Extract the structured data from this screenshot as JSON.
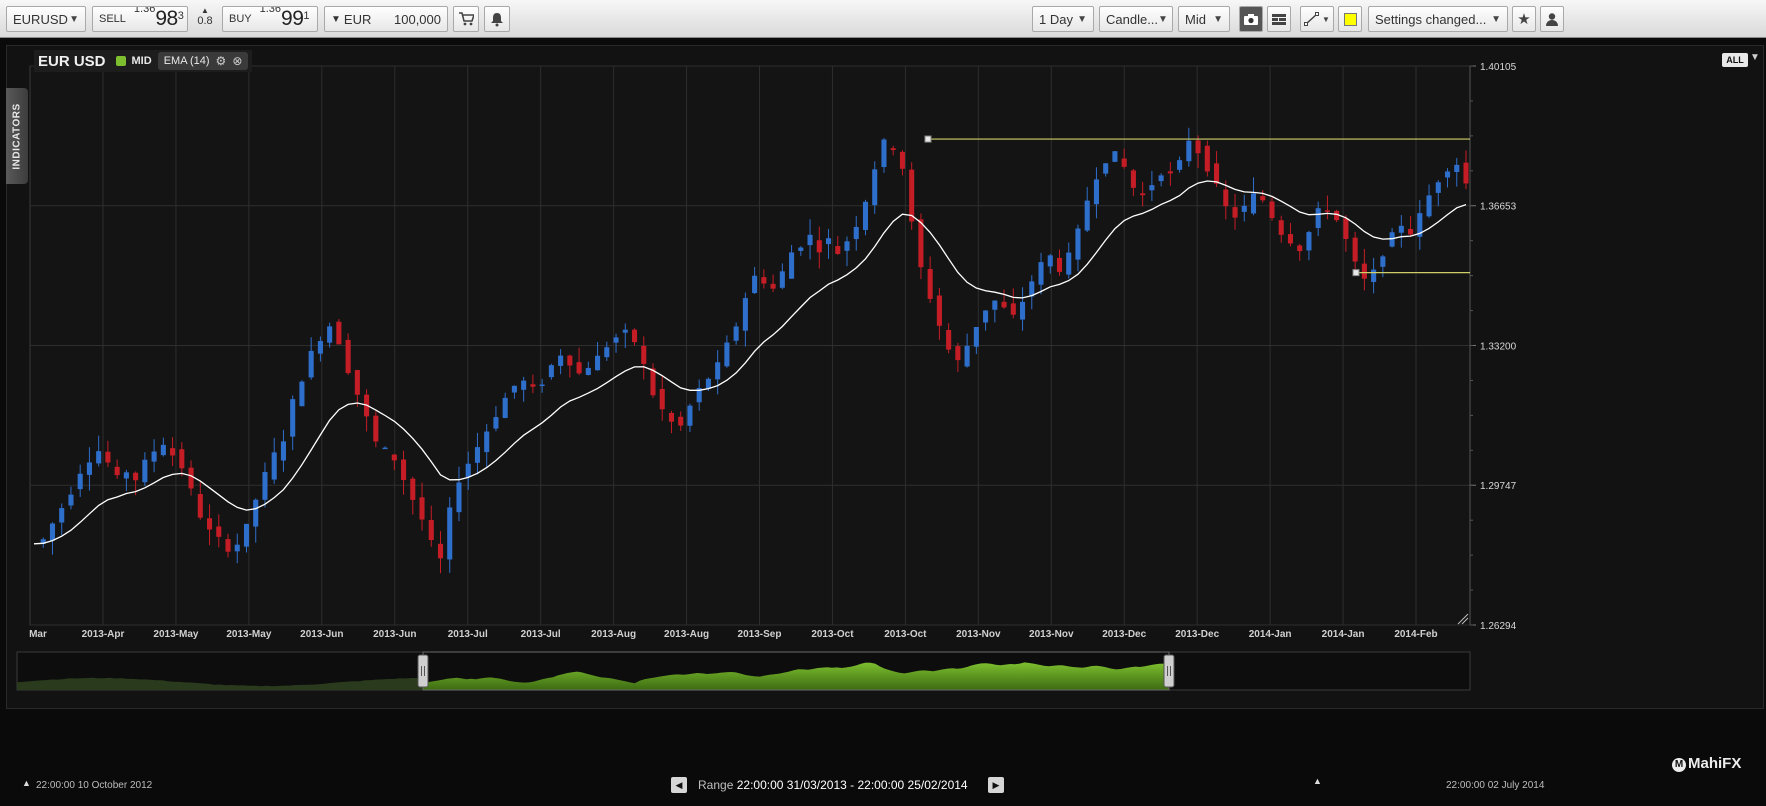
{
  "toolbar": {
    "symbol": "EURUSD",
    "sell_label": "SELL",
    "sell_price_prefix": "1.36",
    "sell_price_big": "98",
    "sell_price_sup": "3",
    "spread": "0.8",
    "buy_label": "BUY",
    "buy_price_prefix": "1.36",
    "buy_price_big": "99",
    "buy_price_sup": "1",
    "currency": "EUR",
    "amount": "100,000",
    "timeframe": "1 Day",
    "chart_type": "Candle...",
    "price_type": "Mid",
    "settings_status": "Settings changed..."
  },
  "legend": {
    "symbol_title": "EUR USD",
    "mid_label": "MID",
    "indicator_label": "EMA (14)"
  },
  "indicators_tab": "INDICATORS",
  "all_button": "ALL",
  "colors": {
    "up": "#2f6fcc",
    "down": "#c51d26",
    "ema": "#ffffff",
    "trendline": "#cfcf6a",
    "navigator_fill": "#7dbf2f"
  },
  "chart_data": {
    "type": "candlestick",
    "y_axis_ticks": [
      "1.40105",
      "1.36653",
      "1.33200",
      "1.29747",
      "1.26294"
    ],
    "ylim": [
      1.26294,
      1.40105
    ],
    "x_tick_labels": [
      "Mar",
      "2013-Apr",
      "2013-May",
      "2013-May",
      "2013-Jun",
      "2013-Jun",
      "2013-Jul",
      "2013-Jul",
      "2013-Aug",
      "2013-Aug",
      "2013-Sep",
      "2013-Oct",
      "2013-Oct",
      "2013-Nov",
      "2013-Nov",
      "2013-Dec",
      "2013-Dec",
      "2014-Jan",
      "2014-Jan",
      "2014-Feb"
    ],
    "close_path": [
      1.283,
      1.284,
      1.288,
      1.292,
      1.296,
      1.301,
      1.304,
      1.306,
      1.303,
      1.299,
      1.301,
      1.299,
      1.303,
      1.306,
      1.308,
      1.305,
      1.302,
      1.296,
      1.29,
      1.286,
      1.284,
      1.282,
      1.283,
      1.287,
      1.294,
      1.3,
      1.305,
      1.309,
      1.318,
      1.324,
      1.33,
      1.334,
      1.337,
      1.333,
      1.326,
      1.32,
      1.314,
      1.308,
      1.306,
      1.304,
      1.299,
      1.294,
      1.289,
      1.283,
      1.279,
      1.291,
      1.299,
      1.303,
      1.307,
      1.311,
      1.315,
      1.319,
      1.322,
      1.323,
      1.321,
      1.323,
      1.327,
      1.33,
      1.328,
      1.325,
      1.327,
      1.329,
      1.332,
      1.334,
      1.335,
      1.333,
      1.327,
      1.32,
      1.316,
      1.313,
      1.312,
      1.317,
      1.321,
      1.324,
      1.327,
      1.332,
      1.337,
      1.344,
      1.349,
      1.348,
      1.346,
      1.35,
      1.355,
      1.357,
      1.359,
      1.356,
      1.358,
      1.355,
      1.358,
      1.362,
      1.368,
      1.376,
      1.382,
      1.381,
      1.376,
      1.362,
      1.351,
      1.344,
      1.337,
      1.331,
      1.328,
      1.332,
      1.337,
      1.341,
      1.343,
      1.341,
      1.339,
      1.343,
      1.348,
      1.352,
      1.354,
      1.351,
      1.354,
      1.36,
      1.368,
      1.374,
      1.378,
      1.379,
      1.376,
      1.371,
      1.369,
      1.372,
      1.375,
      1.374,
      1.377,
      1.383,
      1.38,
      1.376,
      1.371,
      1.366,
      1.364,
      1.366,
      1.369,
      1.368,
      1.364,
      1.36,
      1.358,
      1.356,
      1.36,
      1.365,
      1.366,
      1.363,
      1.358,
      1.352,
      1.348,
      1.35,
      1.355,
      1.359,
      1.362,
      1.36,
      1.364,
      1.369,
      1.373,
      1.376,
      1.377,
      1.372
    ],
    "ema_label": "EMA (14)",
    "trendlines": [
      {
        "from_date": "2013-Oct",
        "level": 1.383
      },
      {
        "from_date": "2014-Jan",
        "level": 1.35
      }
    ]
  },
  "navigator": {
    "start_label": "22:00:00 10 October 2012",
    "end_label": "22:00:00 02 July 2014",
    "range_label": "Range",
    "range_value": "22:00:00 31/03/2013 - 22:00:00 25/02/2014"
  },
  "brand": "MahiFX"
}
